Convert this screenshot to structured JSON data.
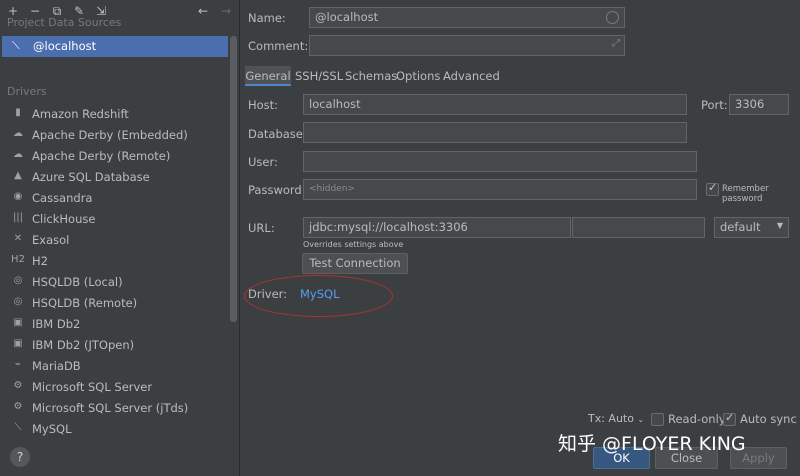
{
  "sidebar": {
    "section_project": "Project Data Sources",
    "data_source": "@localhost",
    "section_drivers": "Drivers",
    "drivers": [
      {
        "label": "Amazon Redshift",
        "icon": "db-icon"
      },
      {
        "label": "Apache Derby (Embedded)",
        "icon": "derby-icon"
      },
      {
        "label": "Apache Derby (Remote)",
        "icon": "derby-icon"
      },
      {
        "label": "Azure SQL Database",
        "icon": "azure-icon"
      },
      {
        "label": "Cassandra",
        "icon": "eye-icon"
      },
      {
        "label": "ClickHouse",
        "icon": "bars-icon"
      },
      {
        "label": "Exasol",
        "icon": "x-icon"
      },
      {
        "label": "H2",
        "icon": "h2-icon"
      },
      {
        "label": "HSQLDB (Local)",
        "icon": "hsqldb-icon"
      },
      {
        "label": "HSQLDB (Remote)",
        "icon": "hsqldb-icon"
      },
      {
        "label": "IBM Db2",
        "icon": "ibm-icon"
      },
      {
        "label": "IBM Db2 (JTOpen)",
        "icon": "ibm-icon"
      },
      {
        "label": "MariaDB",
        "icon": "seal-icon"
      },
      {
        "label": "Microsoft SQL Server",
        "icon": "mssql-icon"
      },
      {
        "label": "Microsoft SQL Server (jTds)",
        "icon": "mssql-icon"
      },
      {
        "label": "MySQL",
        "icon": "dolphin-icon"
      }
    ],
    "help": "?"
  },
  "form": {
    "name_label": "Name:",
    "name_value": "@localhost",
    "comment_label": "Comment:",
    "tabs": [
      "General",
      "SSH/SSL",
      "Schemas",
      "Options",
      "Advanced"
    ],
    "host_label": "Host:",
    "host_value": "localhost",
    "port_label": "Port:",
    "port_value": "3306",
    "database_label": "Database:",
    "user_label": "User:",
    "password_label": "Password:",
    "password_placeholder": "<hidden>",
    "remember_password": "Remember password",
    "url_label": "URL:",
    "url_value": "jdbc:mysql://localhost:3306",
    "url_mode": "default",
    "overrides_note": "Overrides settings above",
    "test_connection": "Test Connection",
    "driver_label": "Driver:",
    "driver_value": "MySQL"
  },
  "footer": {
    "tx": "Tx: Auto",
    "read_only": "Read-only",
    "auto_sync": "Auto sync",
    "ok": "OK",
    "close": "Close",
    "apply": "Apply"
  },
  "watermark": "知乎 @FLOYER KING",
  "colors": {
    "accent": "#4b6eaf",
    "link": "#589df6",
    "highlight_ellipse": "#b43030"
  }
}
